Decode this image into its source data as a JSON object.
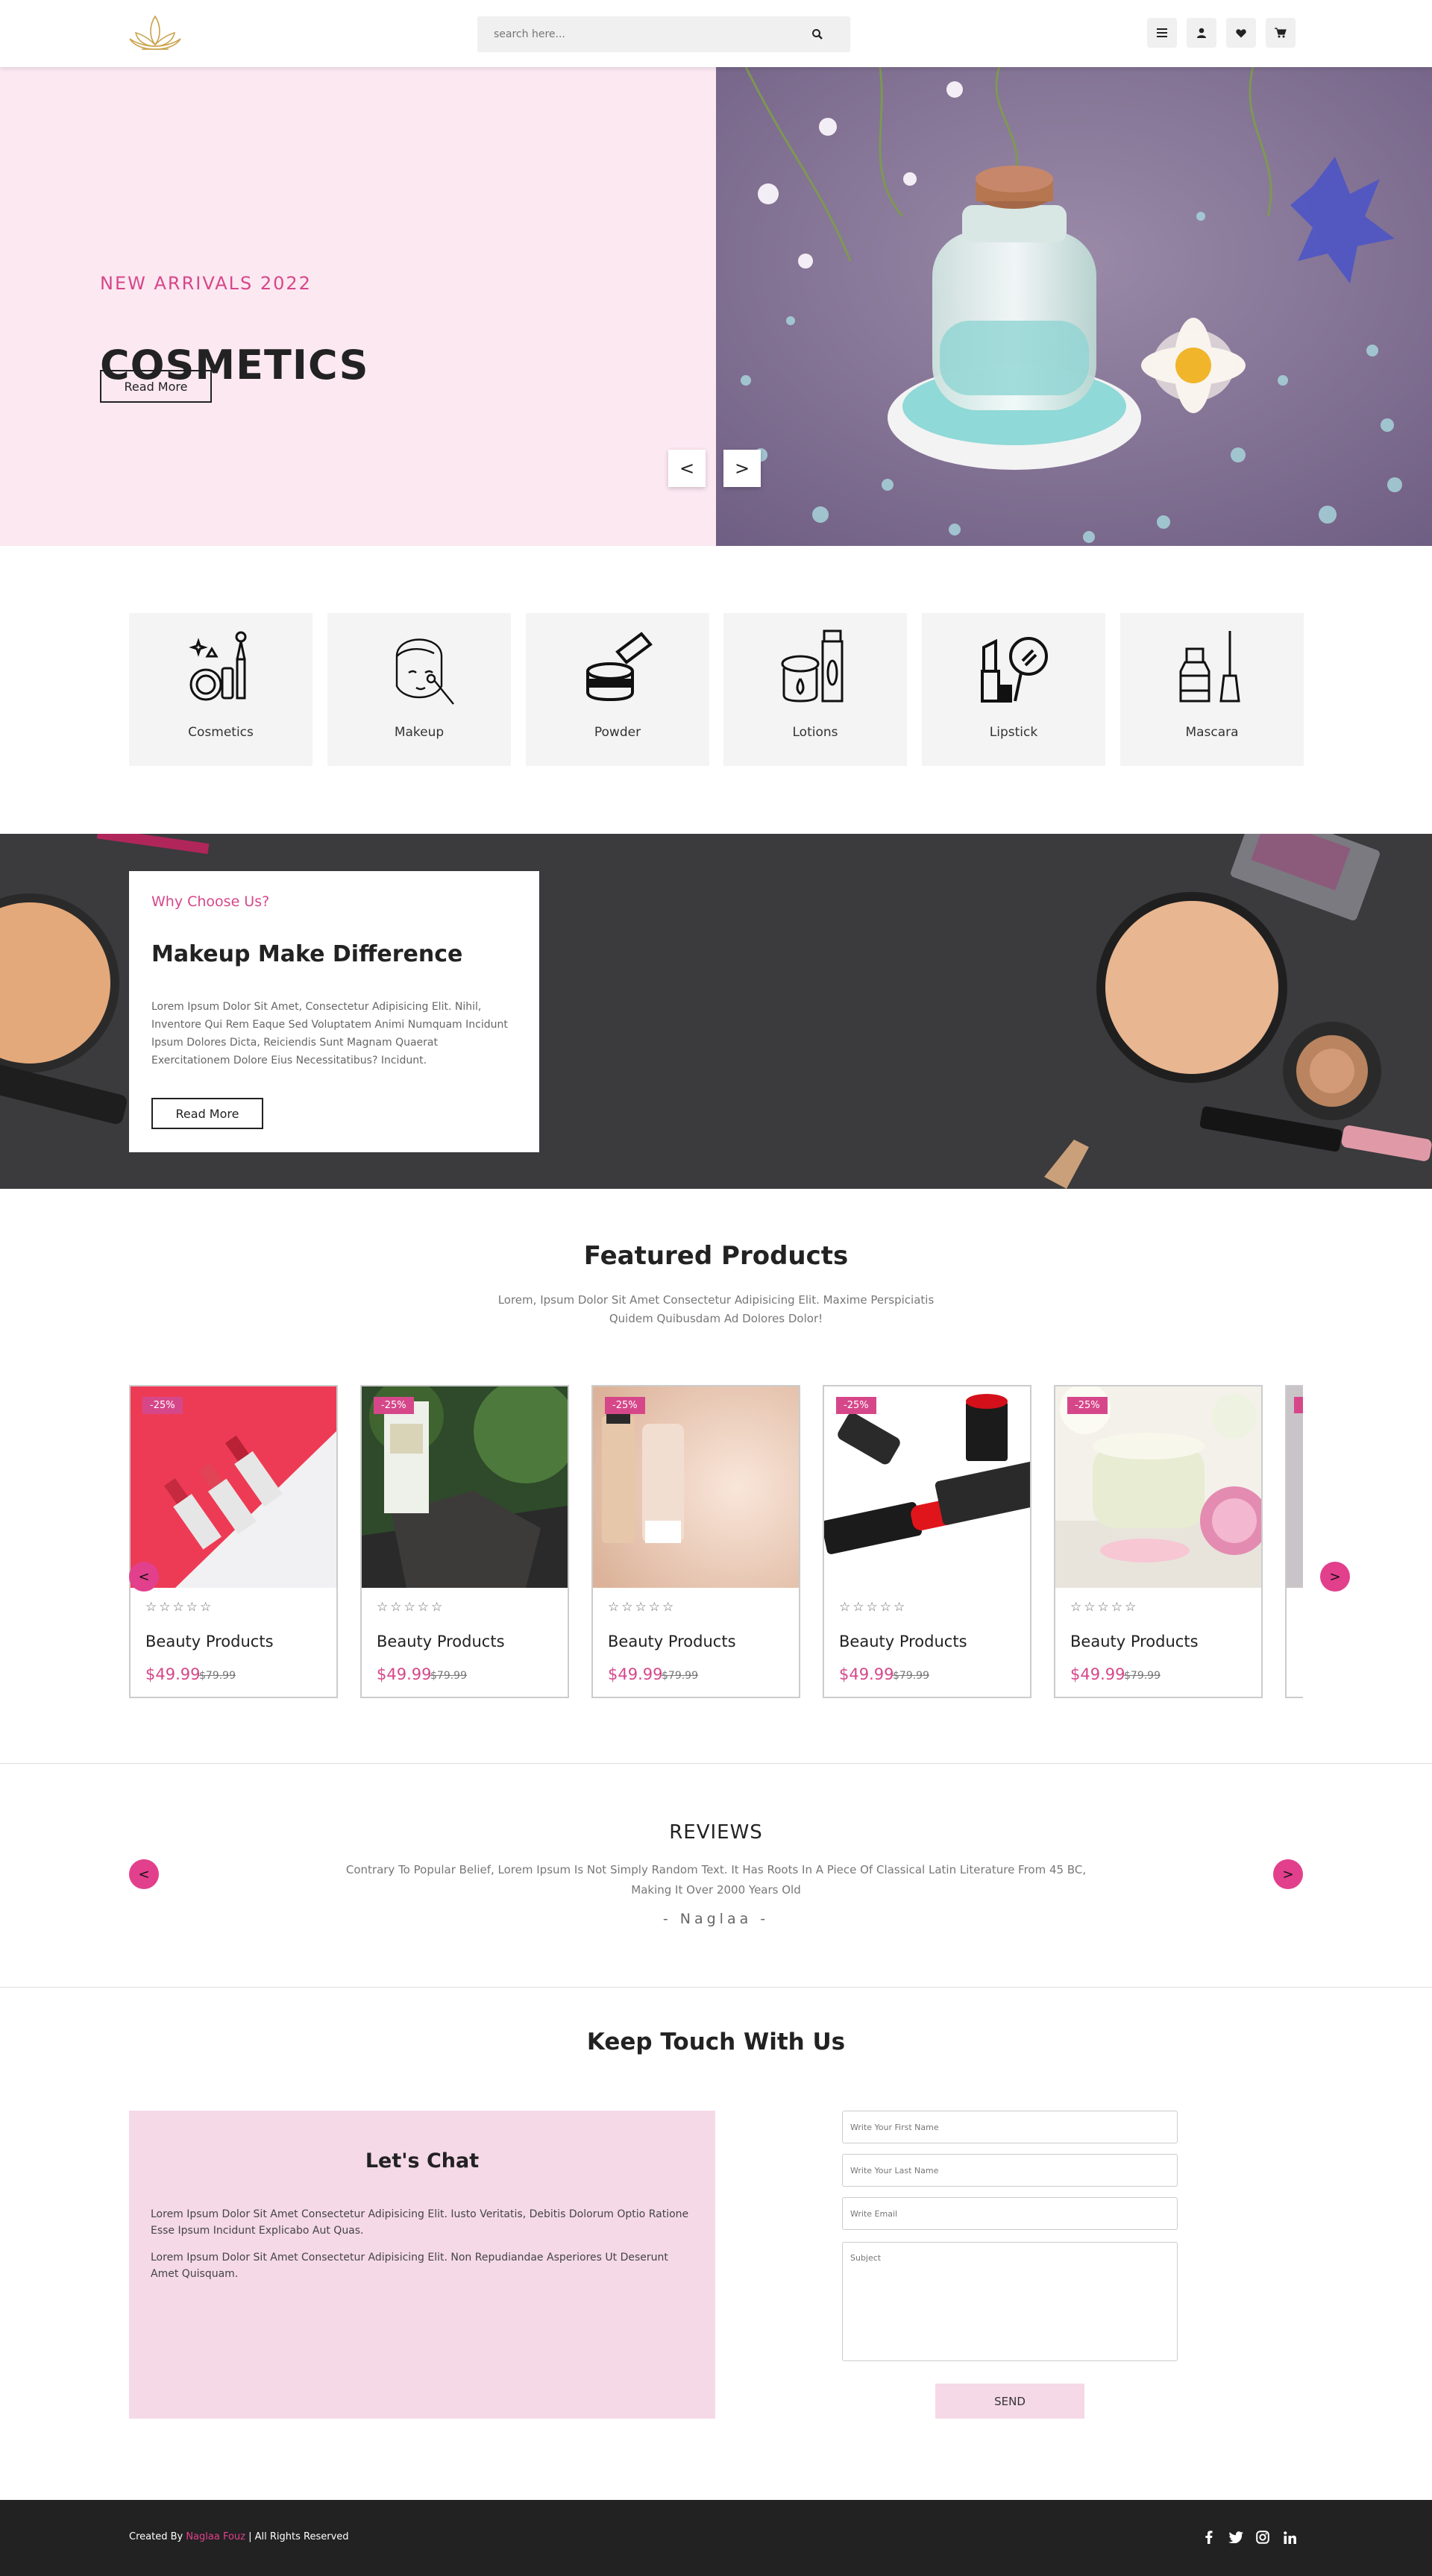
{
  "header": {
    "search_placeholder": "search here..."
  },
  "hero": {
    "subtitle": "NEW ARRIVALS 2022",
    "title": "COSMETICS",
    "button": "Read More",
    "prev": "<",
    "next": ">"
  },
  "categories": [
    {
      "label": "Cosmetics"
    },
    {
      "label": "Makeup"
    },
    {
      "label": "Powder"
    },
    {
      "label": "Lotions"
    },
    {
      "label": "Lipstick"
    },
    {
      "label": "Mascara"
    }
  ],
  "why": {
    "subtitle": "Why Choose Us?",
    "title": "Makeup Make Difference",
    "text": "Lorem Ipsum Dolor Sit Amet, Consectetur Adipisicing Elit. Nihil, Inventore Qui Rem Eaque Sed Voluptatem Animi Numquam Incidunt Ipsum Dolores Dicta, Reiciendis Sunt Magnam Quaerat Exercitationem Dolore Eius Necessitatibus? Incidunt.",
    "button": "Read More"
  },
  "featured": {
    "title": "Featured Products",
    "description": "Lorem, Ipsum Dolor Sit Amet Consectetur Adipisicing Elit. Maxime Perspiciatis Quidem Quibusdam Ad Dolores Dolor!",
    "prev": "<",
    "next": ">",
    "products": [
      {
        "badge": "-25%",
        "stars": "☆☆☆☆☆",
        "name": "Beauty Products",
        "price": "$49.99",
        "old_price": "$79.99"
      },
      {
        "badge": "-25%",
        "stars": "☆☆☆☆☆",
        "name": "Beauty Products",
        "price": "$49.99",
        "old_price": "$79.99"
      },
      {
        "badge": "-25%",
        "stars": "☆☆☆☆☆",
        "name": "Beauty Products",
        "price": "$49.99",
        "old_price": "$79.99"
      },
      {
        "badge": "-25%",
        "stars": "☆☆☆☆☆",
        "name": "Beauty Products",
        "price": "$49.99",
        "old_price": "$79.99"
      },
      {
        "badge": "-25%",
        "stars": "☆☆☆☆☆",
        "name": "Beauty Products",
        "price": "$49.99",
        "old_price": "$79.99"
      }
    ]
  },
  "reviews": {
    "title": "REVIEWS",
    "text": "Contrary To Popular Belief, Lorem Ipsum Is Not Simply Random Text. It Has Roots In A Piece Of Classical Latin Literature From 45 BC, Making It Over 2000 Years Old",
    "author": "- Naglaa -",
    "prev": "<",
    "next": ">"
  },
  "contact": {
    "title": "Keep Touch With Us",
    "chat_title": "Let's Chat",
    "p1": "Lorem Ipsum Dolor Sit Amet Consectetur Adipisicing Elit. Iusto Veritatis, Debitis Dolorum Optio Ratione Esse Ipsum Incidunt Explicabo Aut Quas.",
    "p2": "Lorem Ipsum Dolor Sit Amet Consectetur Adipisicing Elit. Non Repudiandae Asperiores Ut Deserunt Amet Quisquam.",
    "first_name_placeholder": "Write Your First Name",
    "last_name_placeholder": "Write Your Last Name",
    "email_placeholder": "Write Email",
    "subject_placeholder": "Subject",
    "send": "SEND"
  },
  "footer": {
    "created_by": "Created By ",
    "author": "Naglaa Fouz",
    "rights": " | All Rights Reserved"
  },
  "colors": {
    "accent": "#d6478a",
    "pink_bg": "#fce8f1",
    "footer_bg": "#222222"
  },
  "icons": [
    "lotus-logo-icon",
    "search-icon",
    "menu-icon",
    "user-icon",
    "heart-icon",
    "cart-icon",
    "facebook-icon",
    "twitter-icon",
    "instagram-icon",
    "linkedin-icon"
  ]
}
